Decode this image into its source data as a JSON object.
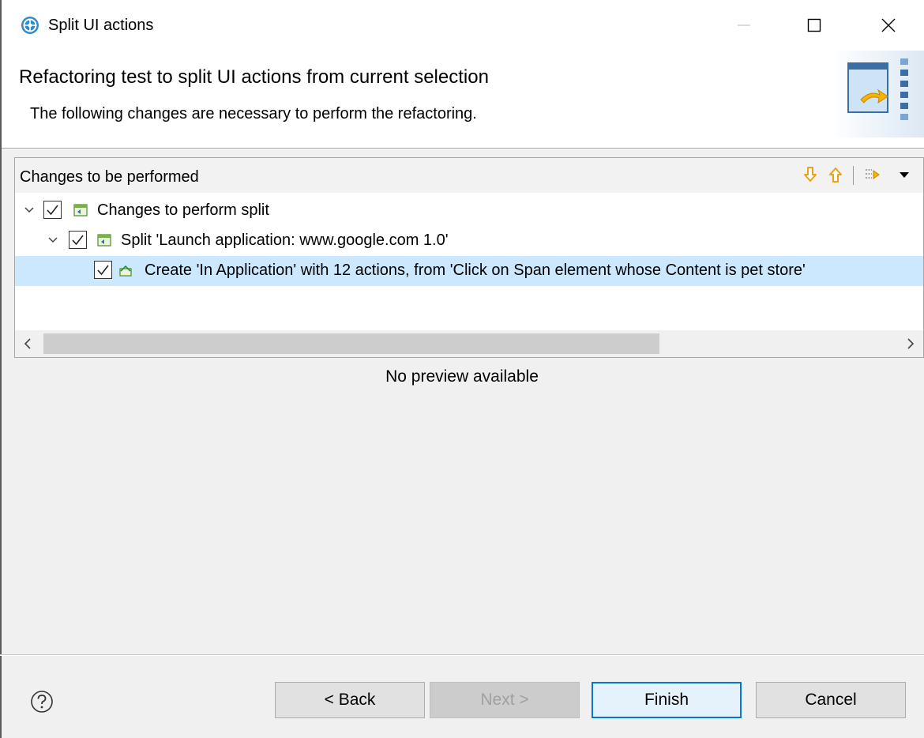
{
  "window": {
    "title": "Split UI actions"
  },
  "header": {
    "title": "Refactoring test to split UI actions from current selection",
    "description": "The following changes are necessary to perform the refactoring."
  },
  "changes_panel": {
    "title": "Changes to be performed",
    "tree": [
      {
        "label": "Changes to perform split",
        "checked": true,
        "expanded": true,
        "depth": 0
      },
      {
        "label": "Split 'Launch application: www.google.com  1.0'",
        "checked": true,
        "expanded": true,
        "depth": 1
      },
      {
        "label": "Create 'In Application' with 12 actions, from 'Click on Span element whose Content is pet store'",
        "checked": true,
        "selected": true,
        "depth": 2
      }
    ]
  },
  "preview": {
    "text": "No preview available"
  },
  "buttons": {
    "back": "< Back",
    "next": "Next >",
    "finish": "Finish",
    "cancel": "Cancel"
  },
  "colors": {
    "selection": "#cce8ff",
    "default_button_border": "#0078d7",
    "nav_arrow": "#e8a317"
  }
}
